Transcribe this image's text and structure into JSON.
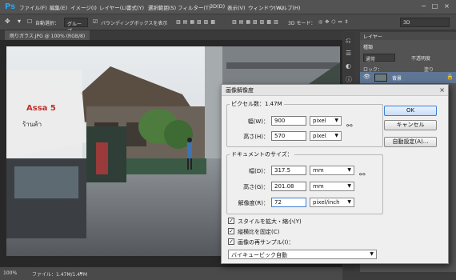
{
  "app": {
    "logo": "Ps"
  },
  "menubar": {
    "items": [
      "ファイル(F)",
      "編集(E)",
      "イメージ(I)",
      "レイヤー(L)",
      "書式(Y)",
      "選択範囲(S)",
      "フィルター(T)",
      "3D(D)",
      "表示(V)",
      "ウィンドウ(W)",
      "ヘルプ(H)"
    ],
    "window_controls": [
      "−",
      "□",
      "×"
    ]
  },
  "options_bar": {
    "auto_select_label": "自動選択：",
    "auto_select_value": "グループ",
    "bounding_box_label": "バウンディングボックスを表示",
    "mode_label": "3D モード：",
    "workspace_value": "3D"
  },
  "document_tab": {
    "label": "雨りガラス.JPG @ 100% (RGB/8)"
  },
  "status_bar": {
    "zoom": "100%",
    "file_info": "ファイル：1.47M/1.47M"
  },
  "layers_panel": {
    "title": "レイヤー",
    "kind_label": "種類",
    "blend_mode": "通常",
    "opacity_label": "不透明度",
    "lock_label": "ロック：",
    "fill_label": "塗り",
    "layer_name": "背景"
  },
  "dialog": {
    "title": "画像解像度",
    "pixel_section": "ピクセル数：1.47M",
    "width_label": "幅(W)：",
    "width_value": "900",
    "width_unit": "pixel",
    "height_label": "高さ(H)：",
    "height_value": "570",
    "height_unit": "pixel",
    "doc_section": "ドキュメントのサイズ：",
    "doc_width_label": "幅(D)：",
    "doc_width_value": "317.5",
    "doc_width_unit": "mm",
    "doc_height_label": "高さ(G)：",
    "doc_height_value": "201.08",
    "doc_height_unit": "mm",
    "resolution_label": "解像度(R)：",
    "resolution_value": "72",
    "resolution_unit": "pixel/inch",
    "scale_styles": "スタイルを拡大・縮小(Y)",
    "constrain": "縦横比を固定(C)",
    "resample": "画像の再サンプル(I)：",
    "resample_method": "バイキュービック自動",
    "ok_label": "OK",
    "cancel_label": "キャンセル",
    "auto_label": "自動設定(A)..."
  },
  "colors": {
    "accent": "#2fa3e8",
    "panel": "#535353",
    "dialog_bg": "#efefef"
  }
}
